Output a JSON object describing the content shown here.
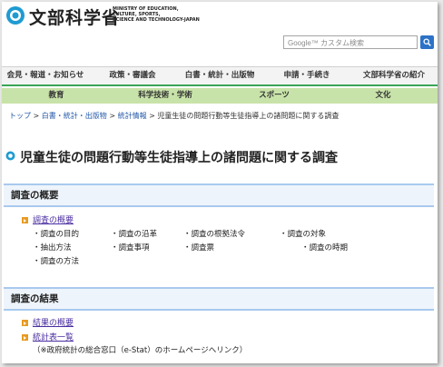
{
  "header": {
    "logo_text": "文部科学省",
    "logo_sub_lines": [
      "MINISTRY OF EDUCATION,",
      "CULTURE, SPORTS,",
      "SCIENCE AND TECHNOLOGY-JAPAN"
    ],
    "search_placeholder": "Google™ カスタム検索"
  },
  "nav_primary": [
    "会見・報道・お知らせ",
    "政策・審議会",
    "白書・統計・出版物",
    "申請・手続き",
    "文部科学省の紹介"
  ],
  "nav_secondary": [
    "教育",
    "科学技術・学術",
    "スポーツ",
    "文化"
  ],
  "breadcrumb": {
    "items": [
      "トップ",
      "白書・統計・出版物",
      "統計情報"
    ],
    "sep": " > ",
    "current": "児童生徒の問題行動等生徒指導上の諸問題に関する調査"
  },
  "page_title": "児童生徒の問題行動等生徒指導上の諸問題に関する調査",
  "section_overview": {
    "heading": "調査の概要",
    "link": "調査の概要",
    "items": [
      "・調査の目的",
      "・調査の沿革",
      "・調査の根拠法令",
      "・調査の対象",
      "・抽出方法",
      "・調査事項",
      "・調査票",
      "・調査の時期",
      "・調査の方法"
    ]
  },
  "section_results": {
    "heading": "調査の結果",
    "link1": "結果の概要",
    "link2": "統計表一覧",
    "note": "（※政府統計の総合窓口（e-Stat）のホームページへリンク）"
  },
  "colors": {
    "nav_green_line": "#3aa556",
    "nav_secondary_bg": "#c8e3a9",
    "section_border": "#a8c9ee",
    "bullet_orange": "#e89a1f",
    "link_purple": "#4a2ea0"
  }
}
